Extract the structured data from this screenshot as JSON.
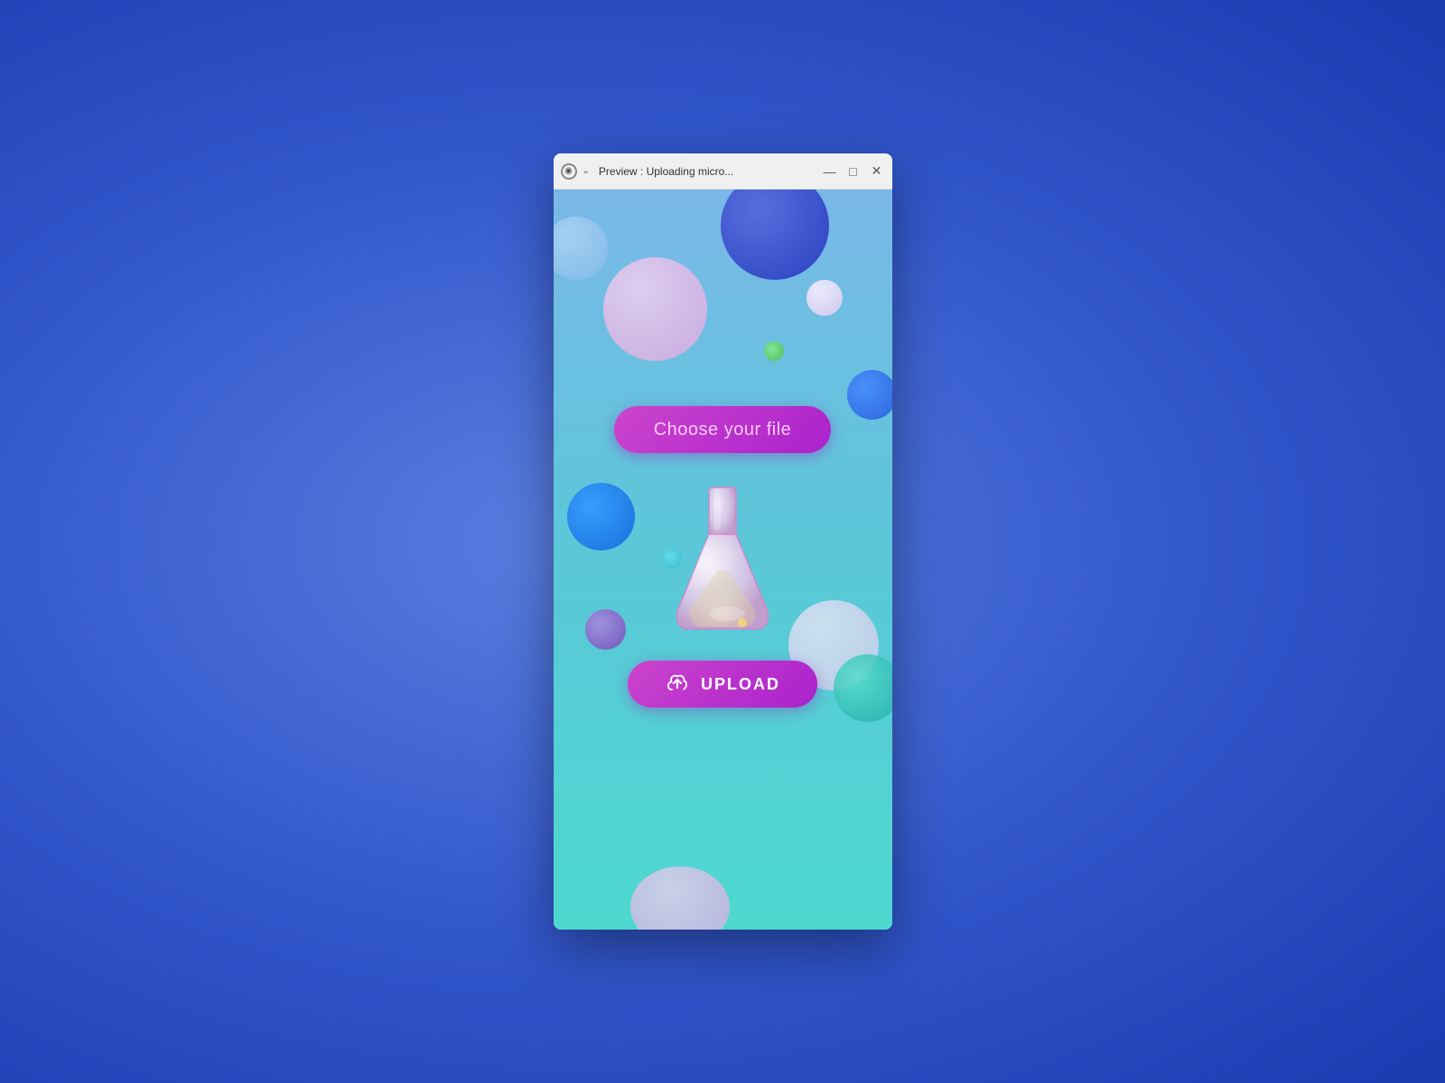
{
  "desktop": {
    "bg_color_from": "#4a6fd8",
    "bg_color_to": "#1a3ab8"
  },
  "titlebar": {
    "title": "Preview : Uploading micro...",
    "minimize_label": "—",
    "maximize_label": "□",
    "close_label": "✕"
  },
  "app": {
    "choose_file_label": "Choose your file",
    "upload_label": "UPLOAD",
    "flask_alt": "chemistry flask icon"
  },
  "bubbles": {
    "colors": {
      "dark_blue": "#2233bb",
      "pink": "#d8a8e0",
      "blue": "#1166dd",
      "teal": "#22aaaa",
      "purple": "#7744bb",
      "green": "#44bb44"
    }
  }
}
